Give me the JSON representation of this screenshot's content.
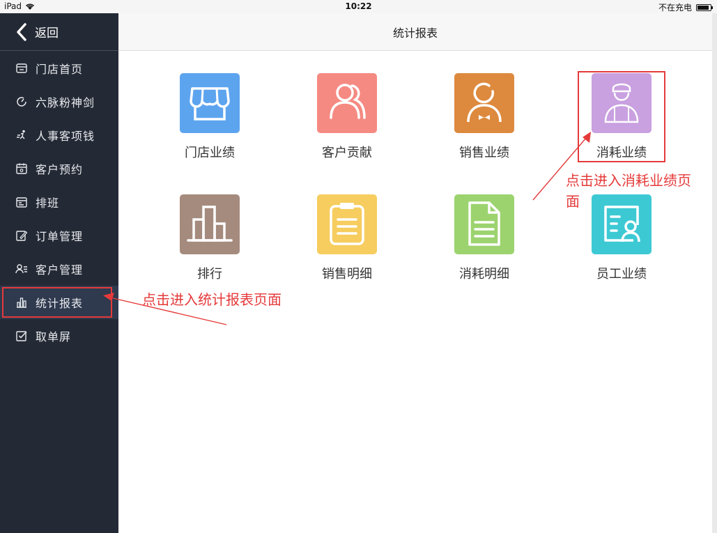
{
  "statusbar": {
    "device": "iPad",
    "time": "10:22",
    "battery_text": "不在充电",
    "battery_level": 0.9
  },
  "sidebar": {
    "back_label": "返回",
    "items": [
      {
        "label": "门店首页",
        "icon": "store-icon"
      },
      {
        "label": "六脉粉神剑",
        "icon": "dial-icon"
      },
      {
        "label": "人事客项钱",
        "icon": "runner-icon"
      },
      {
        "label": "客户预约",
        "icon": "calendar-icon"
      },
      {
        "label": "排班",
        "icon": "schedule-icon"
      },
      {
        "label": "订单管理",
        "icon": "edit-icon"
      },
      {
        "label": "客户管理",
        "icon": "contacts-icon"
      },
      {
        "label": "统计报表",
        "icon": "bar-chart-icon",
        "active": true
      },
      {
        "label": "取单屏",
        "icon": "checkbox-icon"
      }
    ]
  },
  "header": {
    "title": "统计报表"
  },
  "tiles": [
    {
      "label": "门店业绩",
      "color": "#5da4ef",
      "icon": "storefront-icon"
    },
    {
      "label": "客户贡献",
      "color": "#f58a82",
      "icon": "customers-icon"
    },
    {
      "label": "销售业绩",
      "color": "#dd8a3e",
      "icon": "salesperson-icon"
    },
    {
      "label": "消耗业绩",
      "color": "#c9a0e0",
      "icon": "worker-icon"
    },
    {
      "label": "排行",
      "color": "#a58b7e",
      "icon": "ranking-icon"
    },
    {
      "label": "销售明细",
      "color": "#f6cd5e",
      "icon": "clipboard-icon"
    },
    {
      "label": "消耗明细",
      "color": "#9cd36e",
      "icon": "document-icon"
    },
    {
      "label": "员工业绩",
      "color": "#3dc9d4",
      "icon": "id-card-icon"
    }
  ],
  "annotations": {
    "sidebar_note": "点击进入统计报表页面",
    "tile_note_line1": "点击进入消耗业绩页",
    "tile_note_line2": "面",
    "color": "#e53a3a"
  }
}
